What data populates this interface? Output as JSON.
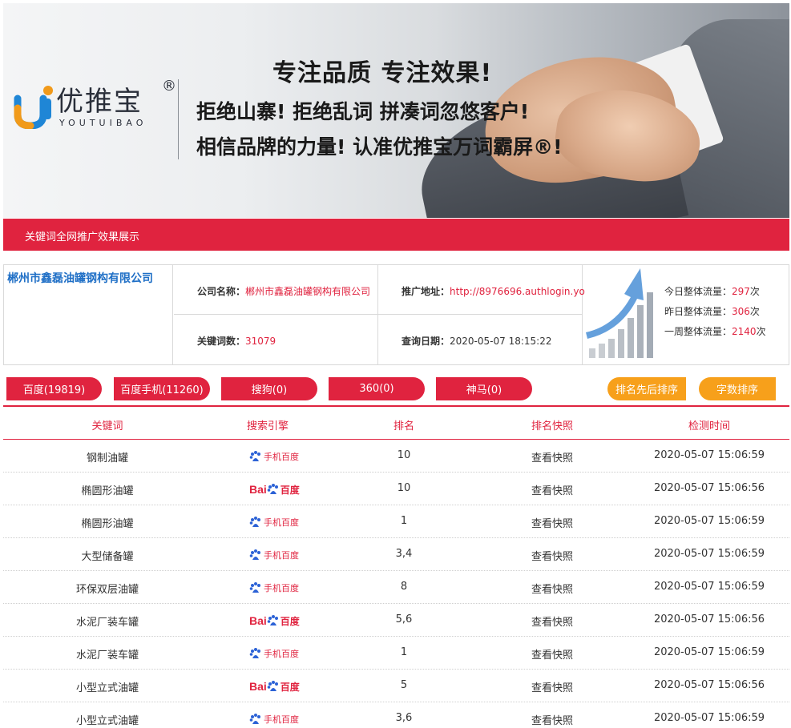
{
  "banner": {
    "brand_name": "优推宝",
    "brand_reg": "®",
    "brand_en": "YOUTUIBAO",
    "slogan_line1": "专注品质 专注效果!",
    "slogan_line2": "拒绝山寨! 拒绝乱词 拼凑词忽悠客户!",
    "slogan_line3": "相信品牌的力量! 认准优推宝万词霸屏®!"
  },
  "title_bar": "关键词全网推广效果展示",
  "info": {
    "company_display": "郴州市鑫磊油罐钢构有限公司",
    "company_label": "公司名称：",
    "company_value": "郴州市鑫磊油罐钢构有限公司",
    "url_label": "推广地址：",
    "url_value": "http://8976696.authlogin.yo",
    "keywords_label": "关键词数：",
    "keywords_value": "31079",
    "date_label": "查询日期：",
    "date_value": "2020-05-07 18:15:22",
    "traffic": [
      {
        "label": "今日整体流量：",
        "value": "297",
        "unit": "次"
      },
      {
        "label": "昨日整体流量：",
        "value": "306",
        "unit": "次"
      },
      {
        "label": "一周整体流量：",
        "value": "2140",
        "unit": "次"
      }
    ]
  },
  "tabs": [
    "百度(19819)",
    "百度手机(11260)",
    "搜狗(0)",
    "360(0)",
    "神马(0)"
  ],
  "sort_buttons": [
    "排名先后排序",
    "字数排序"
  ],
  "table": {
    "headers": [
      "关键词",
      "搜索引擎",
      "排名",
      "排名快照",
      "检测时间"
    ],
    "rows": [
      {
        "keyword": "钢制油罐",
        "engine": "mobile",
        "engine_text": "手机百度",
        "rank": "10",
        "snapshot": "查看快照",
        "time": "2020-05-07 15:06:59"
      },
      {
        "keyword": "椭圆形油罐",
        "engine": "pc",
        "engine_text": "百度",
        "rank": "10",
        "snapshot": "查看快照",
        "time": "2020-05-07 15:06:56"
      },
      {
        "keyword": "椭圆形油罐",
        "engine": "mobile",
        "engine_text": "手机百度",
        "rank": "1",
        "snapshot": "查看快照",
        "time": "2020-05-07 15:06:59"
      },
      {
        "keyword": "大型储备罐",
        "engine": "mobile",
        "engine_text": "手机百度",
        "rank": "3,4",
        "snapshot": "查看快照",
        "time": "2020-05-07 15:06:59"
      },
      {
        "keyword": "环保双层油罐",
        "engine": "mobile",
        "engine_text": "手机百度",
        "rank": "8",
        "snapshot": "查看快照",
        "time": "2020-05-07 15:06:59"
      },
      {
        "keyword": "水泥厂装车罐",
        "engine": "pc",
        "engine_text": "百度",
        "rank": "5,6",
        "snapshot": "查看快照",
        "time": "2020-05-07 15:06:56"
      },
      {
        "keyword": "水泥厂装车罐",
        "engine": "mobile",
        "engine_text": "手机百度",
        "rank": "1",
        "snapshot": "查看快照",
        "time": "2020-05-07 15:06:59"
      },
      {
        "keyword": "小型立式油罐",
        "engine": "pc",
        "engine_text": "百度",
        "rank": "5",
        "snapshot": "查看快照",
        "time": "2020-05-07 15:06:56"
      },
      {
        "keyword": "小型立式油罐",
        "engine": "mobile",
        "engine_text": "手机百度",
        "rank": "3,6",
        "snapshot": "查看快照",
        "time": "2020-05-07 15:06:59"
      }
    ]
  },
  "colors": {
    "primary_red": "#e0233f",
    "sort_orange": "#f7a01b",
    "company_blue": "#1f6fc6"
  },
  "icons": {
    "logo": "youtuibao-logo-icon",
    "trend": "growth-chart-icon",
    "baidu_paw": "baidu-paw-icon"
  }
}
